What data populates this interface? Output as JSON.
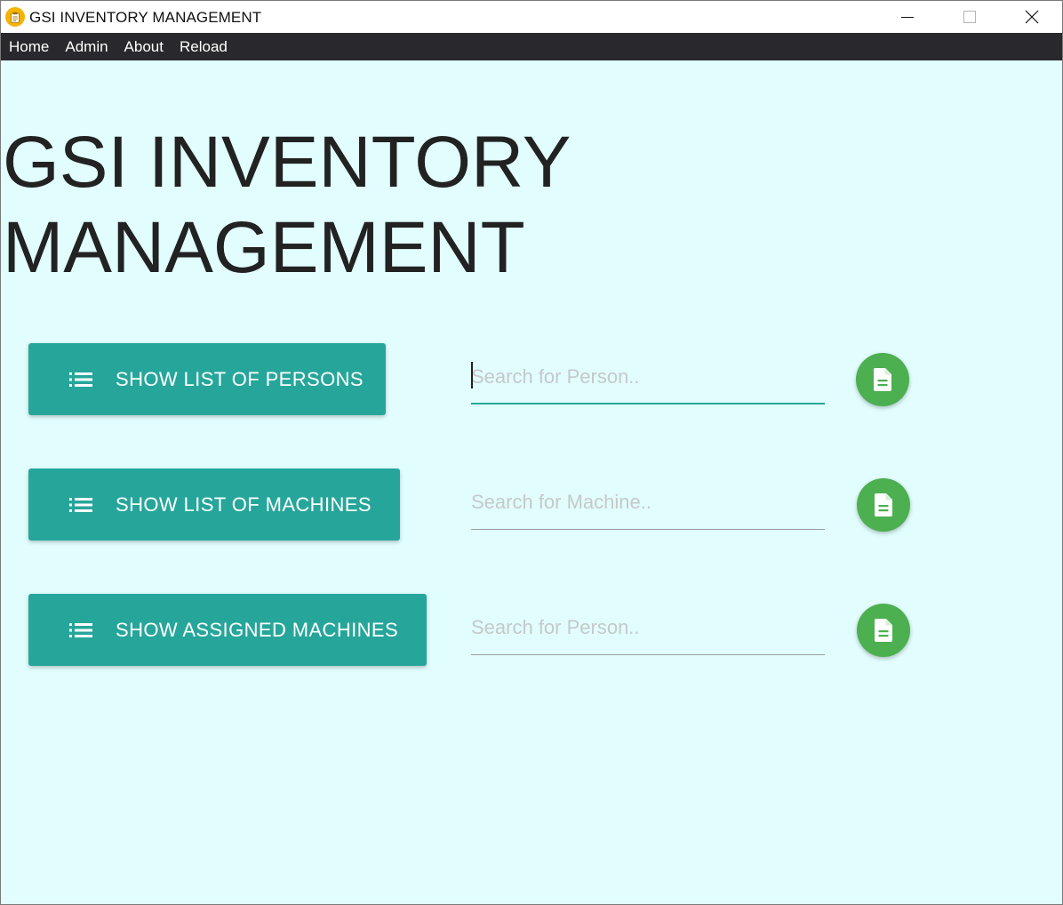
{
  "window": {
    "title": "GSI INVENTORY MANAGEMENT",
    "icon": "app-clipboard-icon",
    "controls": [
      "minimize-icon",
      "maximize-icon",
      "close-icon"
    ]
  },
  "menu": {
    "items": [
      "Home",
      "Admin",
      "About",
      "Reload"
    ]
  },
  "main": {
    "heading_line1": "GSI INVENTORY",
    "heading_line2": "MANAGEMENT",
    "rows": [
      {
        "button_label": "SHOW LIST OF PERSONS",
        "button_icon": "list-icon",
        "search_placeholder": "Search for Person..",
        "search_value": "",
        "action_icon": "document-icon"
      },
      {
        "button_label": "SHOW LIST OF MACHINES",
        "button_icon": "list-icon",
        "search_placeholder": "Search for Machine..",
        "search_value": "",
        "action_icon": "document-icon"
      },
      {
        "button_label": "SHOW ASSIGNED MACHINES",
        "button_icon": "list-icon",
        "search_placeholder": "Search for Person..",
        "search_value": "",
        "action_icon": "document-icon"
      }
    ]
  },
  "colors": {
    "background": "#e1fdfd",
    "menubar": "#29292d",
    "primary_button": "#26a69a",
    "fab": "#4caf50",
    "app_icon": "#f4b400"
  }
}
